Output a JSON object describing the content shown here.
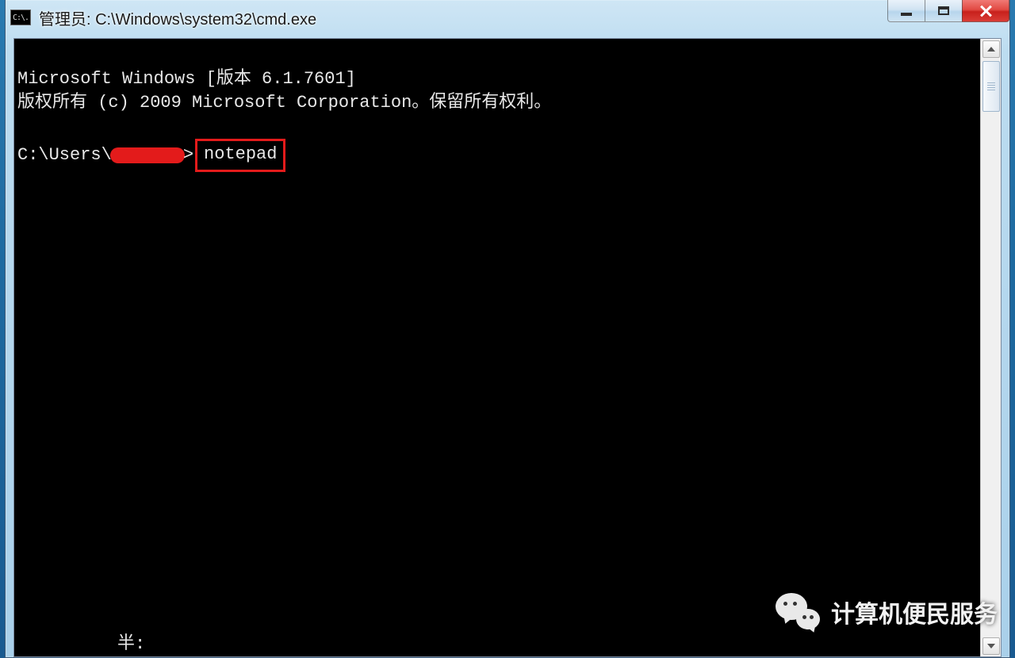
{
  "window": {
    "icon_label": "C:\\.",
    "title": "管理员: C:\\Windows\\system32\\cmd.exe"
  },
  "console": {
    "line1": "Microsoft Windows [版本 6.1.7601]",
    "line2": "版权所有 (c) 2009 Microsoft Corporation。保留所有权利。",
    "prompt_prefix": "C:\\Users\\",
    "prompt_suffix": ">",
    "command": "notepad",
    "status": "半:"
  },
  "watermark": {
    "text": "计算机便民服务"
  }
}
